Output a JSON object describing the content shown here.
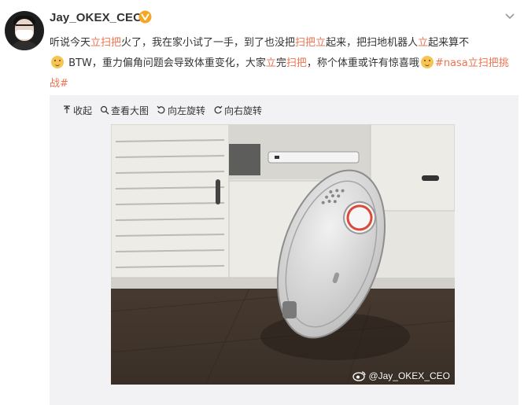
{
  "user": {
    "name": "Jay_OKEX_CEO",
    "verified_icon": "verified-v-badge-icon"
  },
  "post": {
    "text": {
      "s1": "听说今天",
      "h1": "立扫把",
      "s2": "火了，我在家小试了一手，到了也没把",
      "h2": "扫把立",
      "s3": "起来，把扫地机器人",
      "h3": "立",
      "s4": "起来算不",
      "s5": " BTW，重力偏角问题会导致体重变化，大家",
      "h4": "立",
      "s6": "完",
      "h5": "扫把",
      "s7": "，称个体重或许有惊喜哦",
      "tag": "#nasa立扫把挑战#"
    },
    "emoji_icon": "doge-emoji-icon"
  },
  "media": {
    "toolbar": {
      "collapse": "收起",
      "view_large": "查看大图",
      "rotate_left": "向左旋转",
      "rotate_right": "向右旋转"
    },
    "watermark": "@Jay_OKEX_CEO",
    "photo_subject": "robot-vacuum-standing-upright"
  },
  "colors": {
    "highlight": "#eb7350",
    "text": "#333333",
    "media_bg": "#f2f2f5",
    "verified": "#f5a623"
  }
}
